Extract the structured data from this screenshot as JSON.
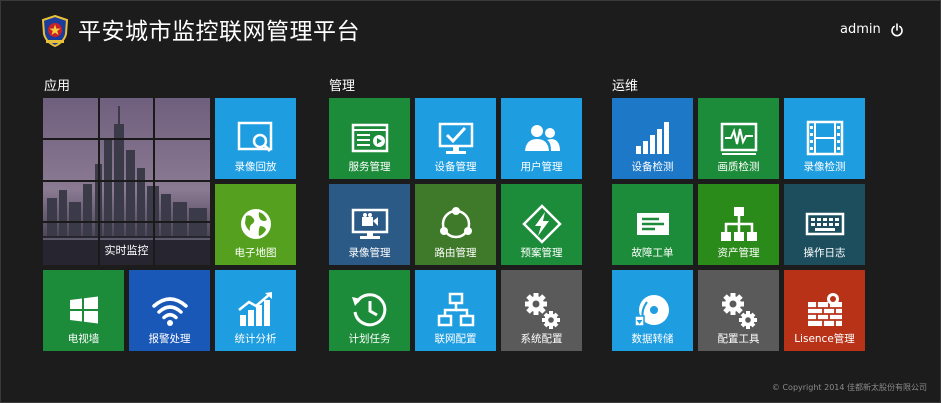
{
  "header": {
    "title": "平安城市监控联网管理平台",
    "user": "admin"
  },
  "sections": [
    {
      "title": "应用"
    },
    {
      "title": "管理"
    },
    {
      "title": "运维"
    }
  ],
  "tiles": {
    "realtime_monitor": {
      "label": "实时监控",
      "icon": "city-photo"
    },
    "record_playback": {
      "label": "录像回放",
      "icon": "search-screen-icon",
      "color": "#1e9de0"
    },
    "e_map": {
      "label": "电子地图",
      "icon": "globe-icon",
      "color": "#55a11f"
    },
    "tv_wall": {
      "label": "电视墙",
      "icon": "windows-icon",
      "color": "#1d8c3a"
    },
    "alarm": {
      "label": "报警处理",
      "icon": "wifi-icon",
      "color": "#1a58b8"
    },
    "stats": {
      "label": "统计分析",
      "icon": "bar-chart-icon",
      "color": "#1e9de0"
    },
    "service_mgmt": {
      "label": "服务管理",
      "icon": "media-panel-icon",
      "color": "#1d8c3a"
    },
    "device_mgmt": {
      "label": "设备管理",
      "icon": "monitor-check-icon",
      "color": "#1e9de0"
    },
    "user_mgmt": {
      "label": "用户管理",
      "icon": "users-icon",
      "color": "#1e9de0"
    },
    "record_mgmt": {
      "label": "录像管理",
      "icon": "camera-screen-icon",
      "color": "#2c5a86"
    },
    "route_mgmt": {
      "label": "路由管理",
      "icon": "route-cycle-icon",
      "color": "#3f7a2a"
    },
    "plan_mgmt": {
      "label": "预案管理",
      "icon": "lightning-icon",
      "color": "#1d8c3a"
    },
    "scheduled_tasks": {
      "label": "计划任务",
      "icon": "clock-icon",
      "color": "#1d8c3a"
    },
    "network_config": {
      "label": "联网配置",
      "icon": "network-tree-icon",
      "color": "#1e9de0"
    },
    "system_config": {
      "label": "系统配置",
      "icon": "gears-icon",
      "color": "#5a5a5a"
    },
    "device_check": {
      "label": "设备检测",
      "icon": "signal-bars-icon",
      "color": "#1e78c8"
    },
    "image_check": {
      "label": "画质检测",
      "icon": "waveform-icon",
      "color": "#1d8c3a"
    },
    "record_check": {
      "label": "录像检测",
      "icon": "film-icon",
      "color": "#1e9de0"
    },
    "fault_ticket": {
      "label": "故障工单",
      "icon": "ticket-icon",
      "color": "#1d8c3a"
    },
    "asset_mgmt": {
      "label": "资产管理",
      "icon": "org-chart-icon",
      "color": "#2a8a1a"
    },
    "operation_log": {
      "label": "操作日志",
      "icon": "keyboard-icon",
      "color": "#1d4e5e"
    },
    "data_transfer": {
      "label": "数据转储",
      "icon": "disc-icon",
      "color": "#1e9de0"
    },
    "config_tools": {
      "label": "配置工具",
      "icon": "gears-icon",
      "color": "#5a5a5a"
    },
    "license_mgmt": {
      "label": "Lisence管理",
      "icon": "brick-wall-icon",
      "color": "#b83218"
    }
  },
  "footer": {
    "copyright": "© Copyright 2014 佳都新太股份有限公司"
  }
}
